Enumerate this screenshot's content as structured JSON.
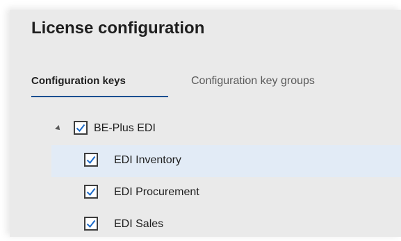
{
  "page": {
    "title": "License configuration"
  },
  "tabs": [
    {
      "label": "Configuration keys",
      "active": true
    },
    {
      "label": "Configuration key groups",
      "active": false
    }
  ],
  "tree": {
    "parent": {
      "label": "BE-Plus EDI",
      "checked": true,
      "expanded": true
    },
    "children": [
      {
        "label": "EDI Inventory",
        "checked": true,
        "selected": true
      },
      {
        "label": "EDI Procurement",
        "checked": true,
        "selected": false
      },
      {
        "label": "EDI Sales",
        "checked": true,
        "selected": false
      }
    ]
  },
  "colors": {
    "panel_bg": "#eaeaea",
    "selected_row": "#e2ebf6",
    "accent": "#1b4f91",
    "checkmark": "#1b6ac9"
  }
}
